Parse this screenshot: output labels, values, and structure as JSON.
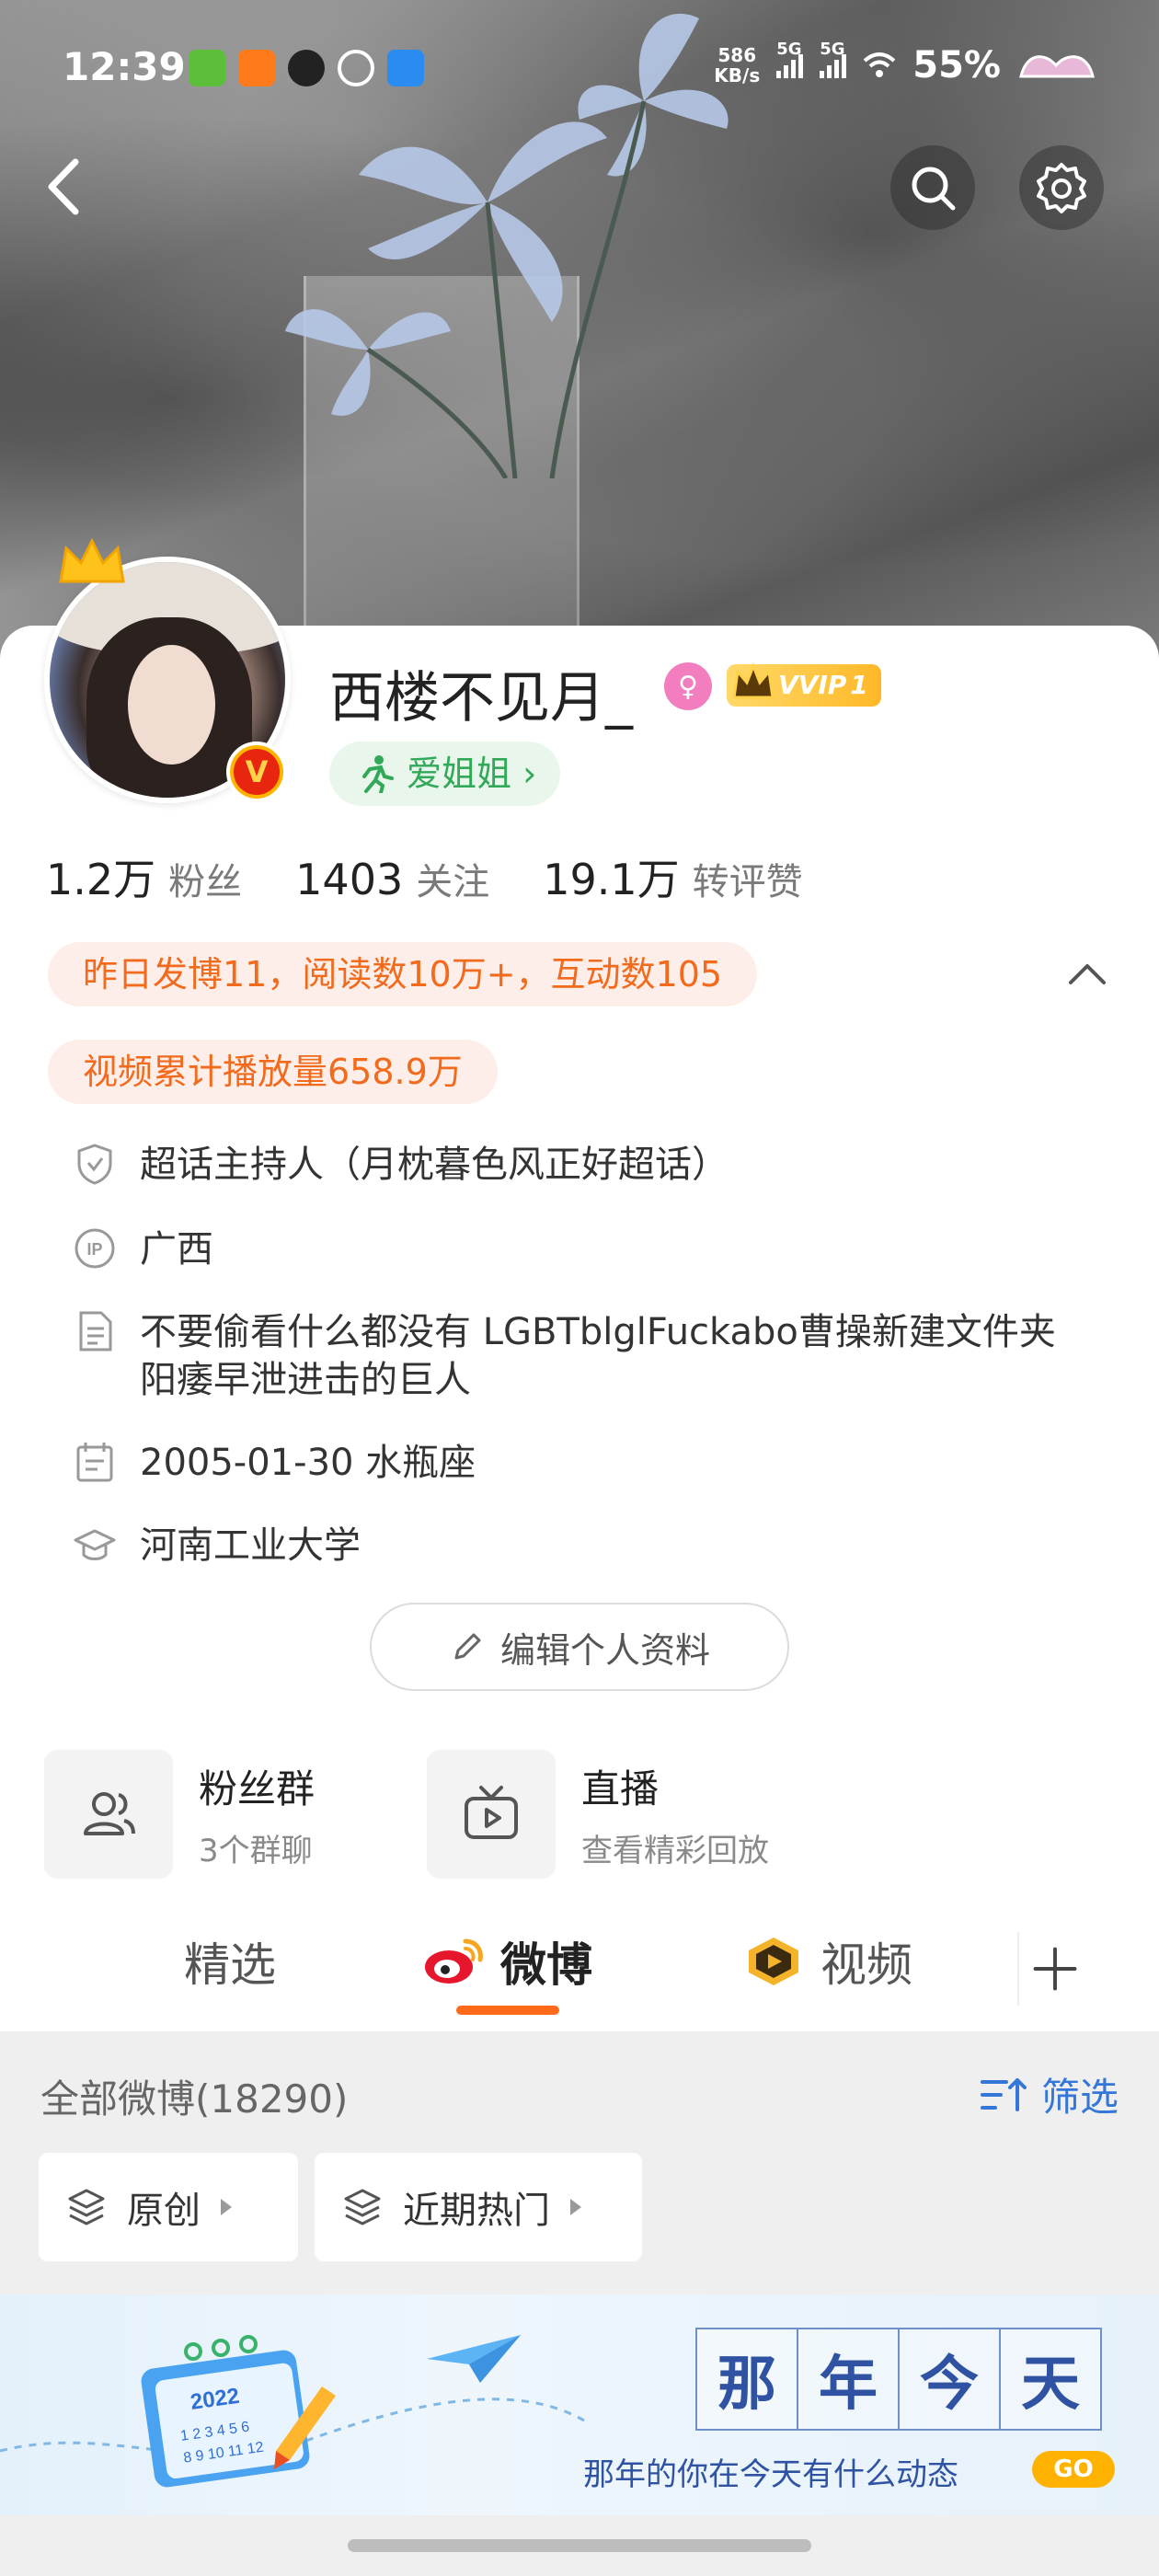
{
  "status_bar": {
    "time": "12:39",
    "net_speed_value": "586",
    "net_speed_unit": "KB/s",
    "sim1": "5G",
    "sim2": "5G",
    "battery": "55%"
  },
  "profile": {
    "nickname": "西楼不见月_",
    "vip_badge": "VVIP",
    "vip_level": "1",
    "tag": "爱姐姐 ›",
    "verified_mark": "V"
  },
  "stats": [
    {
      "value": "1.2万",
      "label": "粉丝"
    },
    {
      "value": "1403",
      "label": "关注"
    },
    {
      "value": "19.1万",
      "label": "转评赞"
    }
  ],
  "highlights": {
    "yesterday": "昨日发博11，阅读数10万+，互动数105",
    "video": "视频累计播放量658.9万"
  },
  "info": {
    "super_topic": "超话主持人（月枕暮色风正好超话）",
    "ip": "广西",
    "bio": "不要偷看什么都没有 LGBTblglFuckabo曹操新建文件夹 阳痿早泄进击的巨人",
    "birthday": "2005-01-30 水瓶座",
    "school": "河南工业大学"
  },
  "edit_button": "编辑个人资料",
  "shortcuts": [
    {
      "title": "粉丝群",
      "subtitle": "3个群聊"
    },
    {
      "title": "直播",
      "subtitle": "查看精彩回放"
    }
  ],
  "tabs": [
    {
      "label": "精选"
    },
    {
      "label": "微博"
    },
    {
      "label": "视频"
    }
  ],
  "feed": {
    "count_label": "全部微博(18290)",
    "filter_label": "筛选",
    "chips": [
      "原创",
      "近期热门"
    ]
  },
  "banner": {
    "title_chars": [
      "那",
      "年",
      "今",
      "天"
    ],
    "subtitle": "那年的你在今天有什么动态",
    "go": "GO",
    "calendar_year": "2022"
  },
  "colors": {
    "accent_orange": "#ff6a1a",
    "highlight_text": "#f26b1d",
    "tag_green": "#31a958",
    "filter_blue": "#3577d9"
  }
}
